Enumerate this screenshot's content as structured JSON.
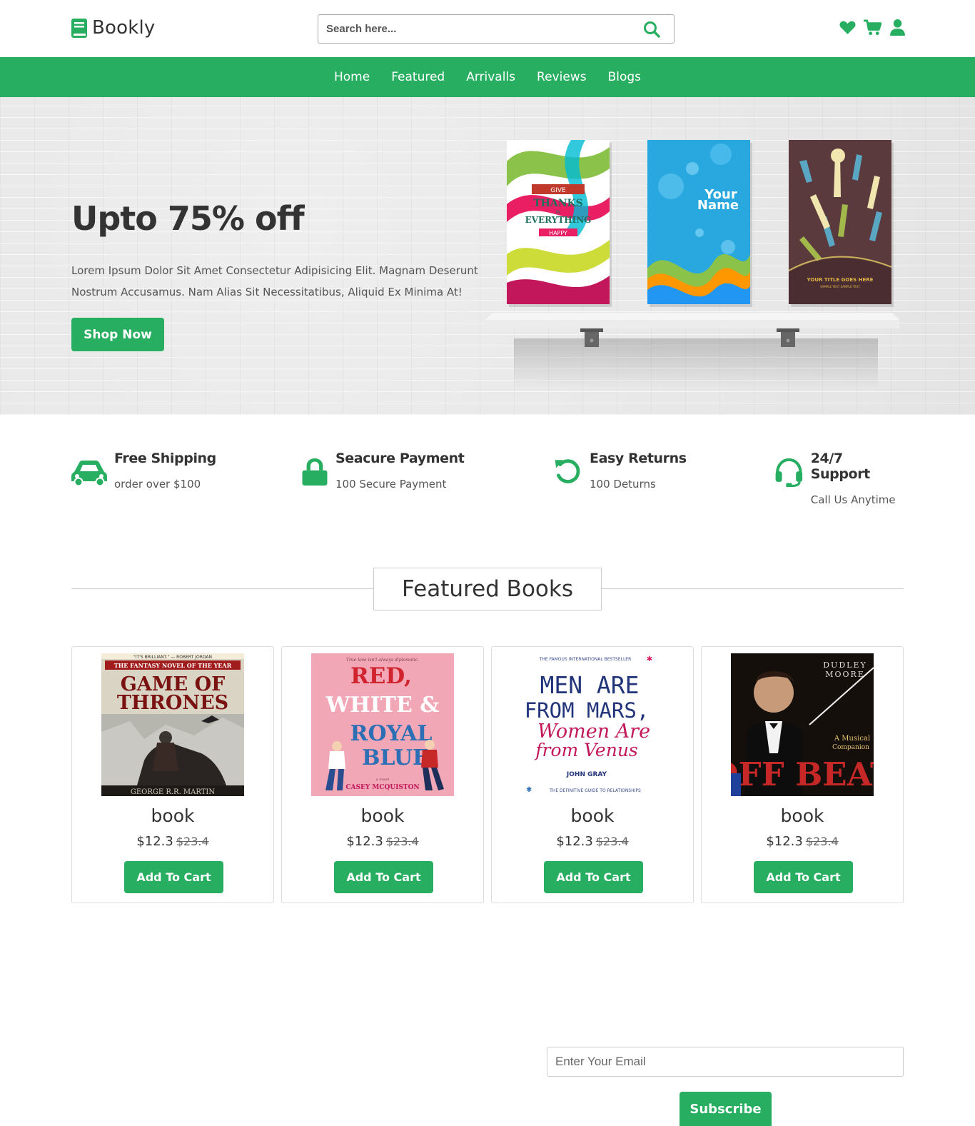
{
  "brand": {
    "name": "Bookly",
    "accent": "#27ae60",
    "icon": "book-icon"
  },
  "search": {
    "placeholder": "Search here...",
    "icon": "search-icon"
  },
  "header_icons": [
    "heart-icon",
    "cart-icon",
    "user-icon"
  ],
  "nav": {
    "items": [
      "Home",
      "Featured",
      "Arrivalls",
      "Reviews",
      "Blogs"
    ]
  },
  "hero": {
    "title": "Upto 75% off",
    "text": "Lorem Ipsum Dolor Sit Amet Consectetur Adipisicing Elit. Magnam Deserunt Nostrum Accusamus. Nam Alias Sit Necessitatibus, Aliquid Ex Minima At!",
    "button": "Shop Now",
    "shelf_books": [
      {
        "lines": [
          "GIVE",
          "THANKS",
          "IN",
          "EVERYTHING",
          "HAPPY"
        ]
      },
      {
        "lines": [
          "Your",
          "Name"
        ]
      },
      {
        "lines": [
          "YOUR TITLE GOES HERE",
          "SAMPLE TEXT SAMPLE TEXT"
        ]
      }
    ]
  },
  "features": [
    {
      "icon": "car-icon",
      "title": "Free Shipping",
      "subtitle": "order over $100"
    },
    {
      "icon": "lock-icon",
      "title": "Seacure Payment",
      "subtitle": "100 Secure Payment"
    },
    {
      "icon": "redo-icon",
      "title": "Easy Returns",
      "subtitle": "100 Deturns"
    },
    {
      "icon": "headset-icon",
      "title": "24/7 Support",
      "subtitle": "Call Us Anytime"
    }
  ],
  "featured": {
    "heading": "Featured Books",
    "books": [
      {
        "name": "book",
        "price": "$12.3",
        "old_price": "$23.4",
        "button": "Add To Cart",
        "cover": {
          "top": "\"IT'S BRILLIANT.\" — ROBERT JORDAN",
          "tag": "THE FANTASY NOVEL OF THE YEAR",
          "title1": "GAME OF",
          "title2": "THRONES",
          "author": "GEORGE R.R. MARTIN"
        }
      },
      {
        "name": "book",
        "price": "$12.3",
        "old_price": "$23.4",
        "button": "Add To Cart",
        "cover": {
          "top": "True love isn't always diplomatic.",
          "title1": "RED,",
          "title2": "WHITE &",
          "title3": "ROYAL",
          "title4": "BLUE",
          "tag": "a novel",
          "author": "CASEY MCQUISTON"
        }
      },
      {
        "name": "book",
        "price": "$12.3",
        "old_price": "$23.4",
        "button": "Add To Cart",
        "cover": {
          "top": "THE FAMOUS INTERNATIONAL BESTSELLER",
          "title1": "MEN ARE",
          "title2": "FROM MARS,",
          "title3": "Women Are",
          "title4": "from Venus",
          "author": "JOHN GRAY",
          "tag": "THE DEFINITIVE GUIDE TO RELATIONSHIPS"
        }
      },
      {
        "name": "book",
        "price": "$12.3",
        "old_price": "$23.4",
        "button": "Add To Cart",
        "cover": {
          "top1": "DUDLEY",
          "top2": "MOORE",
          "tag1": "A Musical",
          "tag2": "Companion",
          "title1": "OFF BEAT"
        }
      }
    ]
  },
  "newsletter": {
    "placeholder": "Enter Your Email",
    "button": "Subscribe"
  }
}
